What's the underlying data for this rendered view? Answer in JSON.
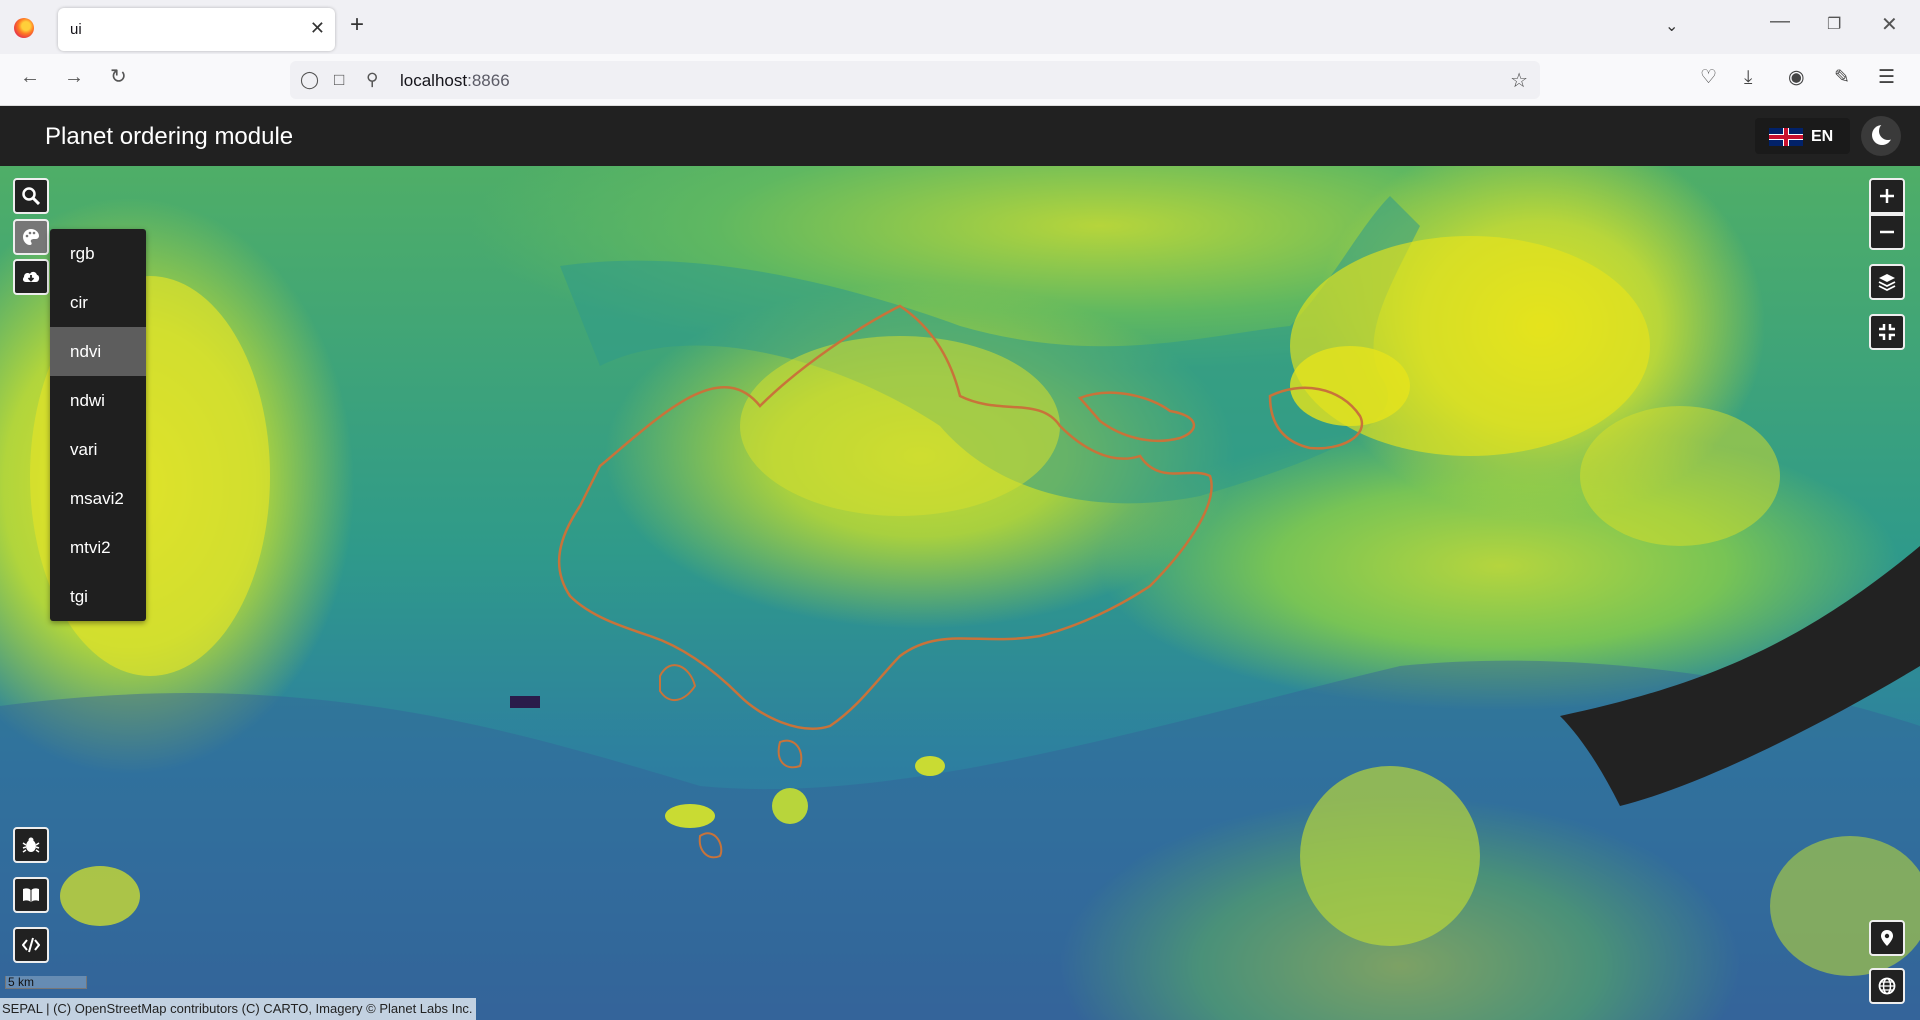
{
  "browser": {
    "tab_title": "ui",
    "tab_close": "✕",
    "new_tab": "+",
    "url_host": "localhost",
    "url_port": ":8866"
  },
  "header": {
    "title": "Planet ordering module",
    "language": "EN"
  },
  "visualization_menu": {
    "items": [
      "rgb",
      "cir",
      "ndvi",
      "ndwi",
      "vari",
      "msavi2",
      "mtvi2",
      "tgi"
    ],
    "selected": "ndvi"
  },
  "map": {
    "scale_label": "5 km",
    "attribution": "SEPAL | (C) OpenStreetMap contributors (C) CARTO, Imagery © Planet Labs Inc.",
    "colors": {
      "aoi_outline": "#c8733a",
      "high_ndvi": "#e4e31d",
      "low_ndvi": "#3d4f8e",
      "nodata": "#222222"
    },
    "icons_left": [
      "search-icon",
      "palette-icon",
      "cloud-download-icon",
      "bug-icon",
      "book-icon",
      "code-icon"
    ],
    "icons_right": [
      "zoom-in-icon",
      "zoom-out-icon",
      "layers-icon",
      "fullscreen-exit-icon",
      "location-pin-icon",
      "globe-icon"
    ]
  }
}
